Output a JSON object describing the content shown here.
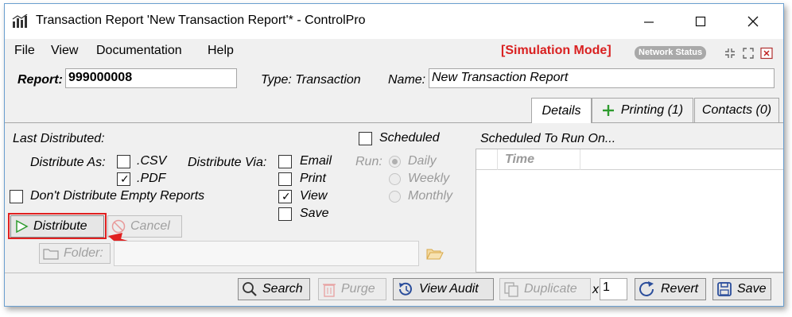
{
  "window": {
    "title": "Transaction Report 'New Transaction Report'* - ControlPro"
  },
  "menu": {
    "items": [
      "File",
      "View",
      "Documentation",
      "Help"
    ],
    "simulation_mode": "[Simulation Mode]",
    "network_status": "Network Status"
  },
  "header": {
    "report_label": "Report:",
    "report_value": "999000008",
    "type_text": "Type: Transaction",
    "name_label": "Name:",
    "name_value": "New Transaction Report"
  },
  "tabs": [
    {
      "label": "Details",
      "active": true
    },
    {
      "label": "Printing (1)",
      "active": false
    },
    {
      "label": "Contacts (0)",
      "active": false
    }
  ],
  "details": {
    "last_distributed_label": "Last Distributed:",
    "distribute_as_label": "Distribute As:",
    "formats": [
      {
        "label": ".CSV",
        "checked": false
      },
      {
        "label": ".PDF",
        "checked": true
      }
    ],
    "distribute_via_label": "Distribute Via:",
    "via": [
      {
        "label": "Email",
        "checked": false
      },
      {
        "label": "Print",
        "checked": false
      },
      {
        "label": "View",
        "checked": true
      },
      {
        "label": "Save",
        "checked": false
      }
    ],
    "dont_distribute_empty": "Don't Distribute Empty Reports",
    "scheduled_label": "Scheduled",
    "run_label": "Run:",
    "run_options": [
      {
        "label": "Daily",
        "selected": true
      },
      {
        "label": "Weekly",
        "selected": false
      },
      {
        "label": "Monthly",
        "selected": false
      }
    ],
    "scheduled_to_run_label": "Scheduled To Run On...",
    "time_column": "Time",
    "distribute_button": "Distribute",
    "cancel_button": "Cancel",
    "folder_button": "Folder:",
    "folder_value": ""
  },
  "toolbar": {
    "search": "Search",
    "purge": "Purge",
    "view_audit": "View Audit",
    "duplicate": "Duplicate",
    "x_label": "x",
    "duplicate_count": "1",
    "revert": "Revert",
    "save": "Save"
  },
  "colors": {
    "simulation": "#d92020",
    "highlight": "#e02020",
    "play_icon": "#2e9b2e",
    "action_blue": "#2a4d9b"
  }
}
